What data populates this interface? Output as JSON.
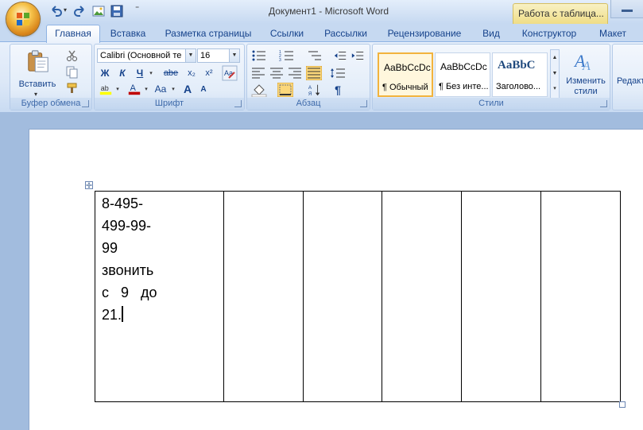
{
  "window": {
    "title": "Документ1 - Microsoft Word",
    "context_tab_title": "Работа с таблица..."
  },
  "quick_access": {
    "icons": [
      "undo-icon",
      "redo-icon",
      "picture-icon",
      "save-icon",
      "customize-icon"
    ]
  },
  "tabs": [
    {
      "label": "Главная",
      "active": true
    },
    {
      "label": "Вставка"
    },
    {
      "label": "Разметка страницы"
    },
    {
      "label": "Ссылки"
    },
    {
      "label": "Рассылки"
    },
    {
      "label": "Рецензирование"
    },
    {
      "label": "Вид"
    },
    {
      "label": "Конструктор"
    },
    {
      "label": "Макет"
    }
  ],
  "ribbon": {
    "clipboard": {
      "label": "Буфер обмена",
      "paste_label": "Вставить"
    },
    "font": {
      "label": "Шрифт",
      "font_name": "Calibri (Основной те",
      "font_size": "16",
      "bold": "Ж",
      "italic": "К",
      "underline": "Ч",
      "strike": "abe",
      "subscript": "x₂",
      "superscript": "x²",
      "case": "Aa",
      "grow": "A",
      "shrink": "A"
    },
    "paragraph": {
      "label": "Абзац",
      "pilcrow": "¶"
    },
    "styles": {
      "label": "Стили",
      "items": [
        {
          "sample": "AaBbCcDc",
          "name": "¶ Обычный",
          "active": true
        },
        {
          "sample": "AaBbCcDc",
          "name": "¶ Без инте..."
        },
        {
          "sample": "AaBbC",
          "name": "Заголово..."
        }
      ],
      "change_styles_label": "Изменить стили"
    },
    "editing": {
      "label": "Редакт"
    }
  },
  "document": {
    "table": {
      "columns": 6,
      "first_cell_lines": [
        "8-495-",
        "499-99-",
        "99",
        "звонить",
        "с   9   до",
        "21."
      ]
    }
  },
  "colors": {
    "ribbon_bg": "#dbe7f7",
    "doc_bg": "#a2bcde",
    "accent_text": "#15428b",
    "active_style_border": "#f2b33d",
    "font_color": "#c00000",
    "highlight_color": "#ffff00"
  }
}
